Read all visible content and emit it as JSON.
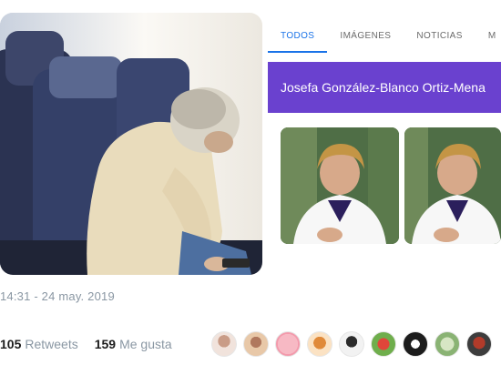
{
  "tweet": {
    "timestamp": "14:31 - 24 may. 2019",
    "retweets_count": "105",
    "retweets_label": "Retweets",
    "likes_count": "159",
    "likes_label": "Me gusta"
  },
  "search": {
    "tabs": [
      {
        "label": "TODOS",
        "active": true
      },
      {
        "label": "IMÁGENES",
        "active": false
      },
      {
        "label": "NOTICIAS",
        "active": false
      },
      {
        "label": "M",
        "active": false
      }
    ],
    "knowledge_panel_title": "Josefa González-Blanco Ortiz-Mena"
  },
  "colors": {
    "accent_tab": "#1a73e8",
    "panel_header": "#6a41cf",
    "muted_text": "#8a97a3"
  }
}
